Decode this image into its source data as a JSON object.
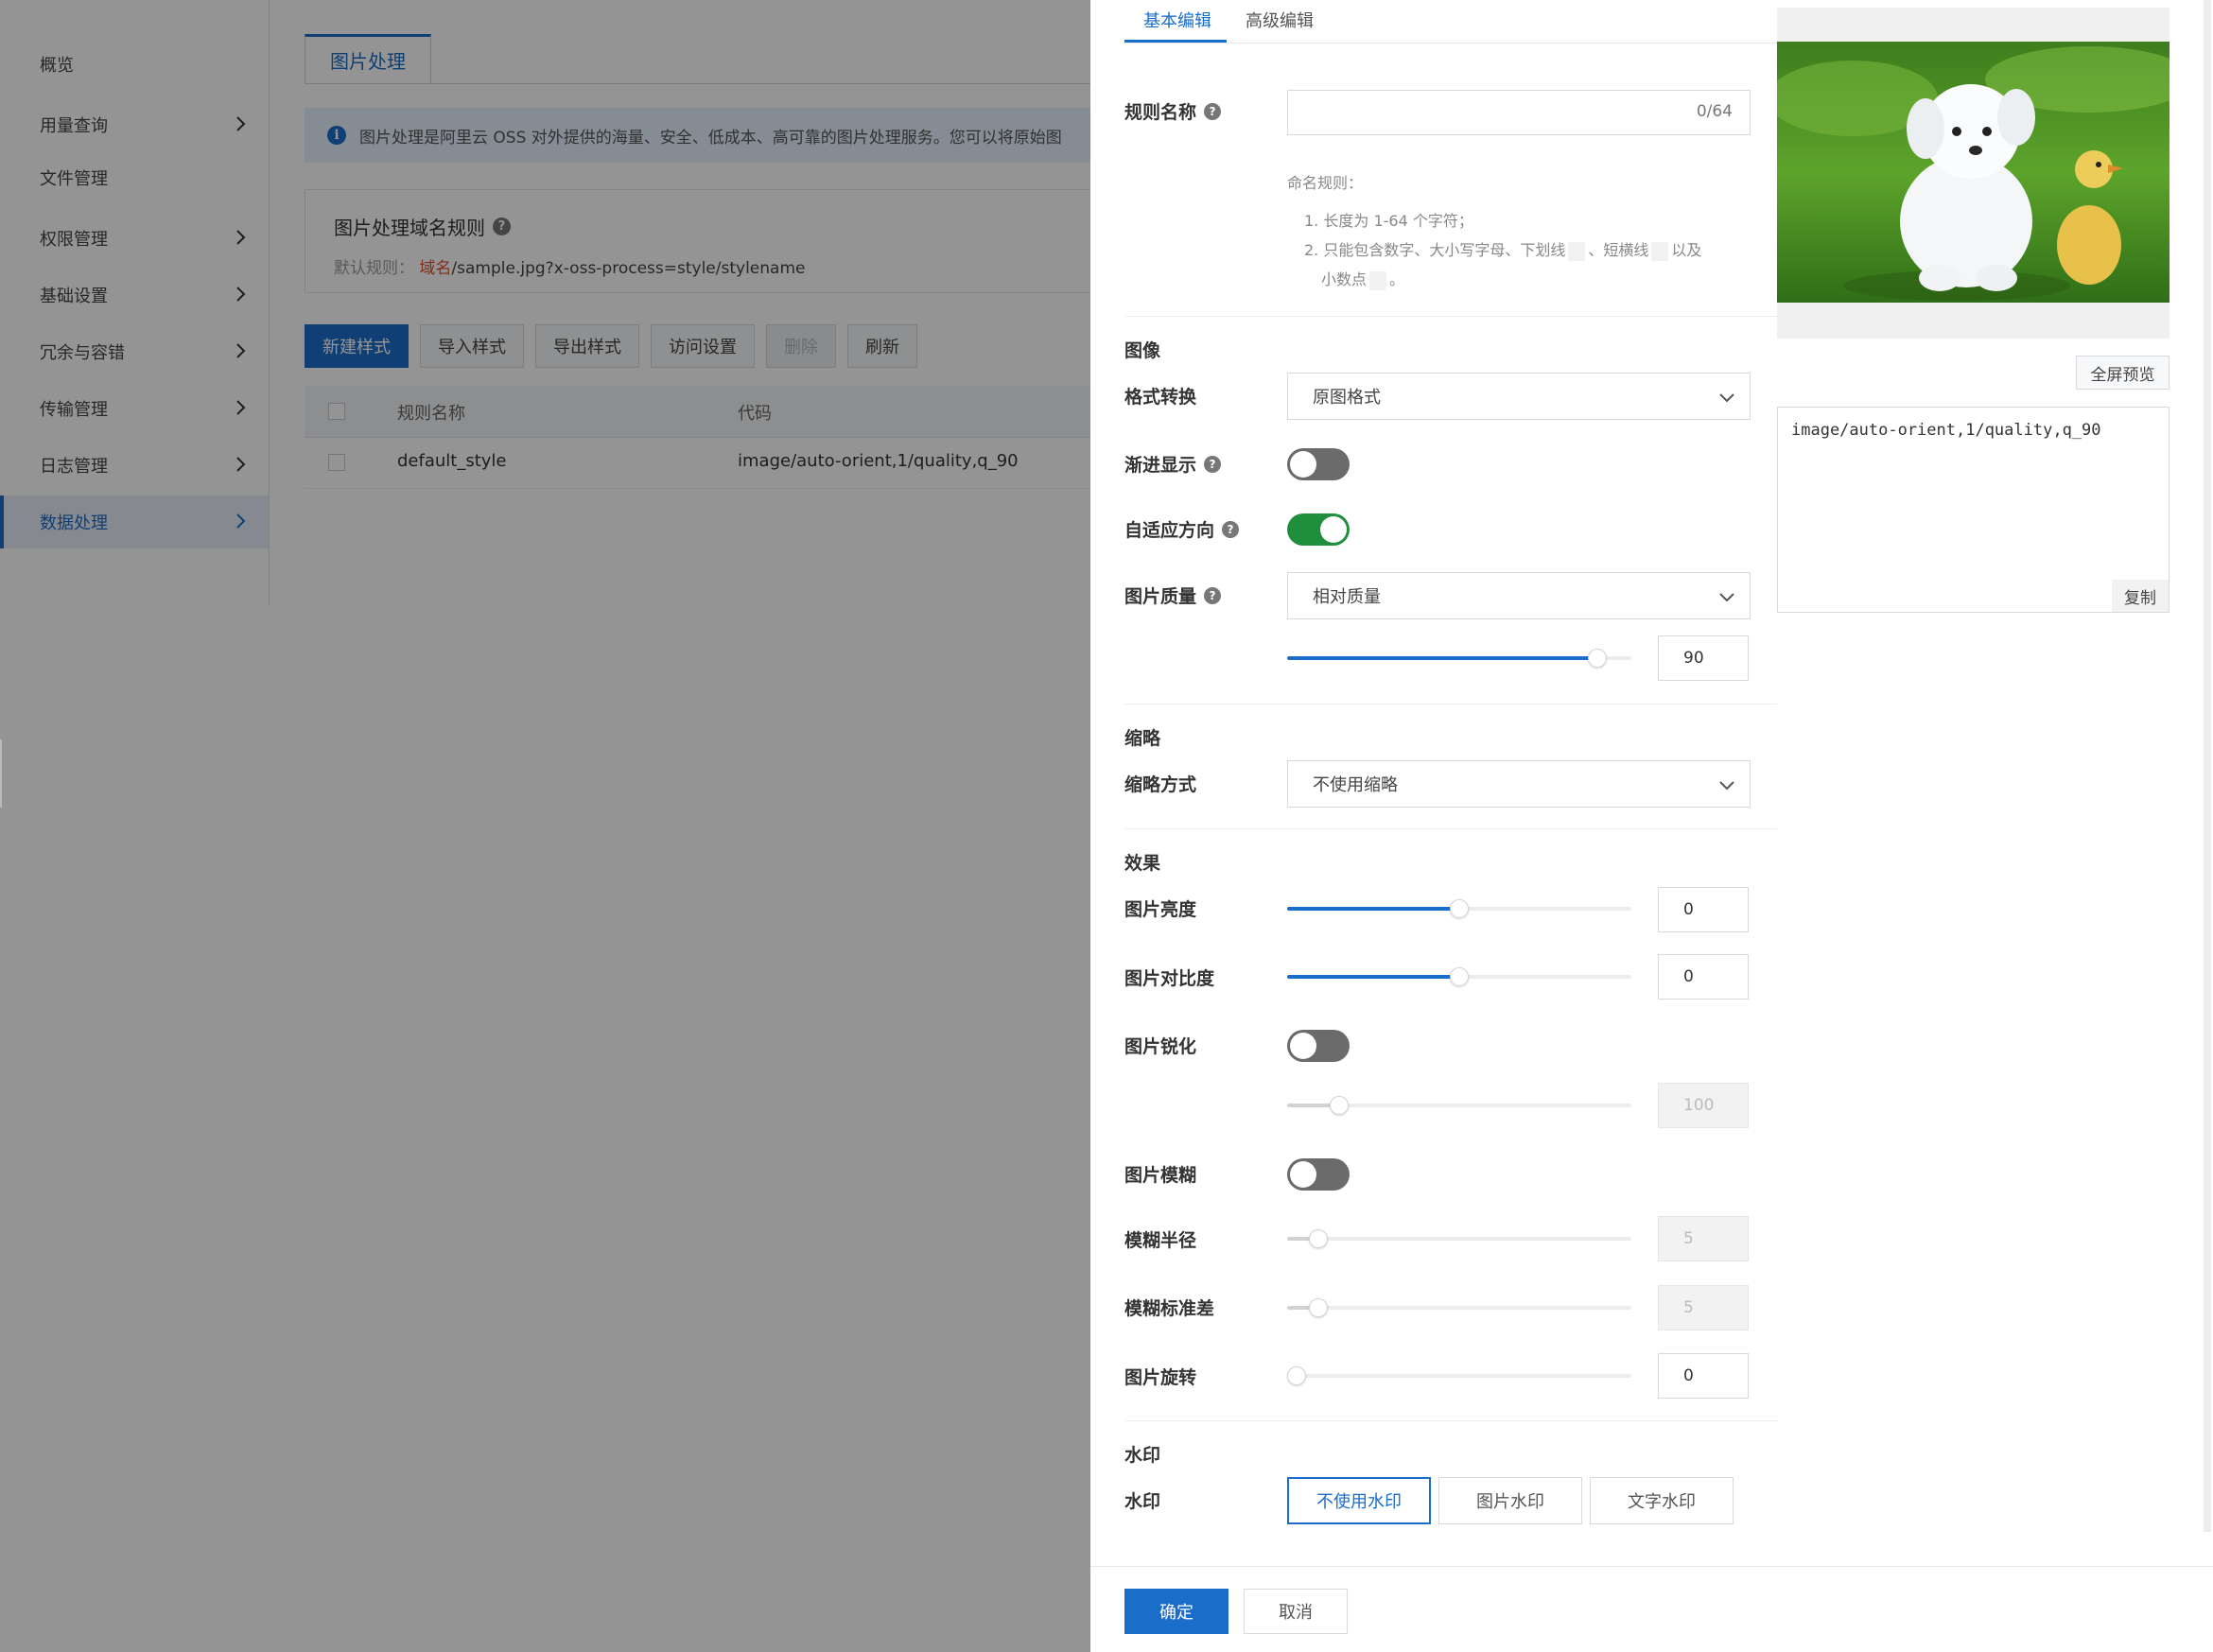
{
  "sidebar": {
    "items": [
      {
        "label": "概览"
      },
      {
        "label": "用量查询"
      },
      {
        "label": "文件管理"
      },
      {
        "label": "权限管理"
      },
      {
        "label": "基础设置"
      },
      {
        "label": "冗余与容错"
      },
      {
        "label": "传输管理"
      },
      {
        "label": "日志管理"
      },
      {
        "label": "数据处理"
      }
    ]
  },
  "main": {
    "tab_label": "图片处理",
    "info_text": "图片处理是阿里云 OSS 对外提供的海量、安全、低成本、高可靠的图片处理服务。您可以将原始图",
    "domain_title": "图片处理域名规则",
    "default_rule_label": "默认规则：",
    "default_rule_domain": "域名",
    "default_rule_path": "/sample.jpg?x-oss-process=style/stylename",
    "toolbar": [
      "新建样式",
      "导入样式",
      "导出样式",
      "访问设置",
      "删除",
      "刷新"
    ],
    "table": {
      "headers": [
        "规则名称",
        "代码"
      ],
      "rows": [
        {
          "name": "default_style",
          "code": "image/auto-orient,1/quality,q_90"
        }
      ]
    }
  },
  "drawer": {
    "tabs": [
      "基本编辑",
      "高级编辑"
    ],
    "rule_name": {
      "label": "规则名称",
      "counter": "0/64"
    },
    "naming_rules": {
      "title": "命名规则：",
      "line1": "1. 长度为 1-64 个字符；",
      "line2a": "2. 只能包含数字、大小写字母、下划线",
      "line2b": "、短横线",
      "line2c": "以及",
      "line3a": "小数点",
      "line3b": "。"
    },
    "image_section": {
      "title": "图像",
      "format_label": "格式转换",
      "format_value": "原图格式",
      "progressive_label": "渐进显示",
      "progressive_on": false,
      "auto_orient_label": "自适应方向",
      "auto_orient_on": true,
      "quality_label": "图片质量",
      "quality_mode": "相对质量",
      "quality_value": "90",
      "quality_fraction": 0.9
    },
    "thumb_section": {
      "title": "缩略",
      "mode_label": "缩略方式",
      "mode_value": "不使用缩略"
    },
    "effect_section": {
      "title": "效果",
      "brightness_label": "图片亮度",
      "brightness_value": "0",
      "brightness_fraction": 0.5,
      "contrast_label": "图片对比度",
      "contrast_value": "0",
      "contrast_fraction": 0.5,
      "sharpen_label": "图片锐化",
      "sharpen_on": false,
      "sharpen_value": "100",
      "sharpen_fraction": 0.15,
      "blur_label": "图片模糊",
      "blur_on": false,
      "blur_radius_label": "模糊半径",
      "blur_radius_value": "5",
      "blur_radius_fraction": 0.09,
      "blur_sigma_label": "模糊标准差",
      "blur_sigma_value": "5",
      "blur_sigma_fraction": 0.09,
      "rotate_label": "图片旋转",
      "rotate_value": "0",
      "rotate_fraction": 0.0
    },
    "watermark_section": {
      "title": "水印",
      "label": "水印",
      "options": [
        "不使用水印",
        "图片水印",
        "文字水印"
      ],
      "selected": "不使用水印"
    },
    "footer": {
      "ok": "确定",
      "cancel": "取消"
    },
    "preview": {
      "fullscreen_label": "全屏预览",
      "code": "image/auto-orient,1/quality,q_90",
      "copy_label": "复制"
    }
  },
  "colors": {
    "accent": "#1a6dc9",
    "toggle_on": "#1f8e3d",
    "toggle_off": "#6b6b6b",
    "warning_text": "#e04d2c"
  }
}
